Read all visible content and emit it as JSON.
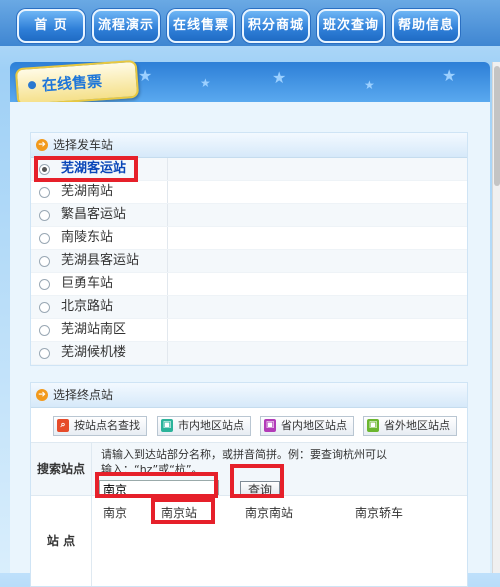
{
  "nav": {
    "items": [
      "首  页",
      "流程演示",
      "在线售票",
      "积分商城",
      "班次查询",
      "帮助信息"
    ]
  },
  "panel_title": "在线售票",
  "departure": {
    "header": "选择发车站",
    "stations": [
      "芜湖客运站",
      "芜湖南站",
      "繁昌客运站",
      "南陵东站",
      "芜湖县客运站",
      "巨勇车站",
      "北京路站",
      "芜湖站南区",
      "芜湖候机楼"
    ],
    "selected_index": 0
  },
  "destination": {
    "header": "选择终点站",
    "tool_buttons": [
      {
        "label": "按站点名查找",
        "color": "#e64b2a"
      },
      {
        "label": "市内地区站点",
        "color": "#2bb39a"
      },
      {
        "label": "省内地区站点",
        "color": "#b23bb8"
      },
      {
        "label": "省外地区站点",
        "color": "#6bb62f"
      }
    ],
    "search_label": "搜索站点",
    "hint": "请输入到达站部分名称，或拼音简拼。例：要查询杭州可以输入：“hz”或“杭”。",
    "search_value": "南京",
    "query_button": "查询",
    "station_label": "站 点",
    "results": [
      "南京",
      "南京站",
      "南京南站",
      "南京轿车"
    ]
  },
  "colors": {
    "highlight": "#e6202a",
    "accent": "#2d7fd7"
  }
}
